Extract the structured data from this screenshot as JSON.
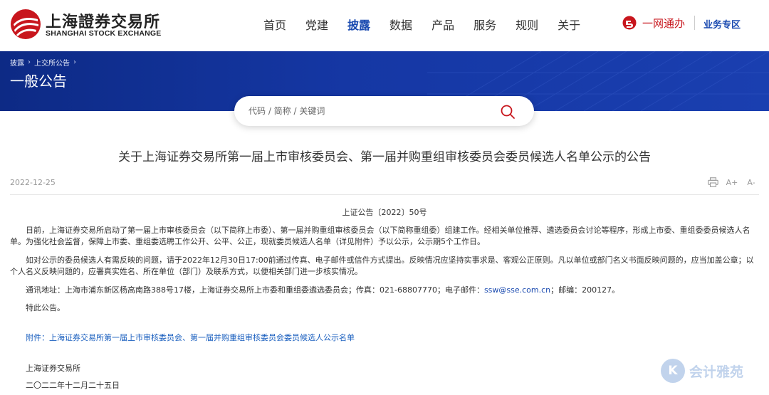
{
  "header": {
    "logo_cn": "上海證券交易所",
    "logo_en": "SHANGHAI STOCK EXCHANGE",
    "nav": [
      "首页",
      "党建",
      "披露",
      "数据",
      "产品",
      "服务",
      "规则",
      "关于"
    ],
    "nav_active": "披露",
    "yiwang_label": "一网通办",
    "biz_zone": "业务专区"
  },
  "banner": {
    "breadcrumb": [
      "披露",
      "上交所公告"
    ],
    "title": "一般公告"
  },
  "search": {
    "placeholder": "代码 / 简称 / 关键词"
  },
  "article": {
    "title": "关于上海证券交易所第一届上市审核委员会、第一届并购重组审核委员会委员候选人名单公示的公告",
    "date": "2022-12-25",
    "tools": [
      "print",
      "A+",
      "A-"
    ],
    "doc_no": "上证公告〔2022〕50号",
    "p1": "日前，上海证券交易所启动了第一届上市审核委员会（以下简称上市委）、第一届并购重组审核委员会（以下简称重组委）组建工作。经相关单位推荐、遴选委员会讨论等程序，形成上市委、重组委委员候选人名单。为强化社会监督，保障上市委、重组委选聘工作公开、公平、公正，现就委员候选人名单（详见附件）予以公示，公示期5个工作日。",
    "p2": "如对公示的委员候选人有需反映的问题，请于2022年12月30日17:00前通过传真、电子邮件或信件方式提出。反映情况应坚持实事求是、客观公正原则。凡以单位或部门名义书面反映问题的，应当加盖公章；以个人名义反映问题的，应署真实姓名、所在单位（部门）及联系方式，以便相关部门进一步核实情况。",
    "p3_prefix": "通讯地址：上海市浦东新区杨高南路388号17楼，上海证券交易所上市委和重组委遴选委员会；传真：021-68807770；电子邮件：",
    "p3_email": "ssw@sse.com.cn",
    "p3_suffix": "；邮编：200127。",
    "p4": "特此公告。",
    "attachment": "附件：上海证券交易所第一届上市审核委员会、第一届并购重组审核委员会委员候选人公示名单",
    "sign_org": "上海证券交易所",
    "sign_date": "二〇二二年十二月二十五日"
  },
  "watermark": {
    "icon_letter": "K",
    "text": "会计雅苑"
  },
  "colors": {
    "brand_red": "#c8161d",
    "brand_blue": "#1a4ab0",
    "banner_blue": "#1537a4"
  }
}
